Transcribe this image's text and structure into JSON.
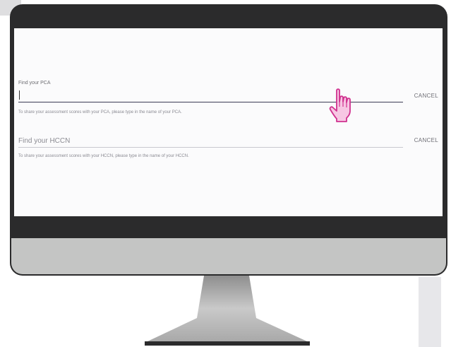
{
  "form": {
    "pca": {
      "label": "Find your PCA",
      "value": "",
      "cancel_label": "CANCEL",
      "helper_text": "To share your assessment scores with your PCA, please type in the name of your PCA."
    },
    "hccn": {
      "placeholder": "Find your HCCN",
      "cancel_label": "CANCEL",
      "helper_text": "To share your assessment scores with your HCCN, please type in the name of your HCCN."
    }
  },
  "icons": {
    "cursor": "hand-pointer-icon"
  },
  "colors": {
    "bezel": "#2b2b2c",
    "chin": "#c4c5c4",
    "screen_bg": "#fbfbfc",
    "active_underline": "#3b3b55",
    "cursor_fill": "#f7c7e3",
    "cursor_stroke": "#d0318f"
  }
}
